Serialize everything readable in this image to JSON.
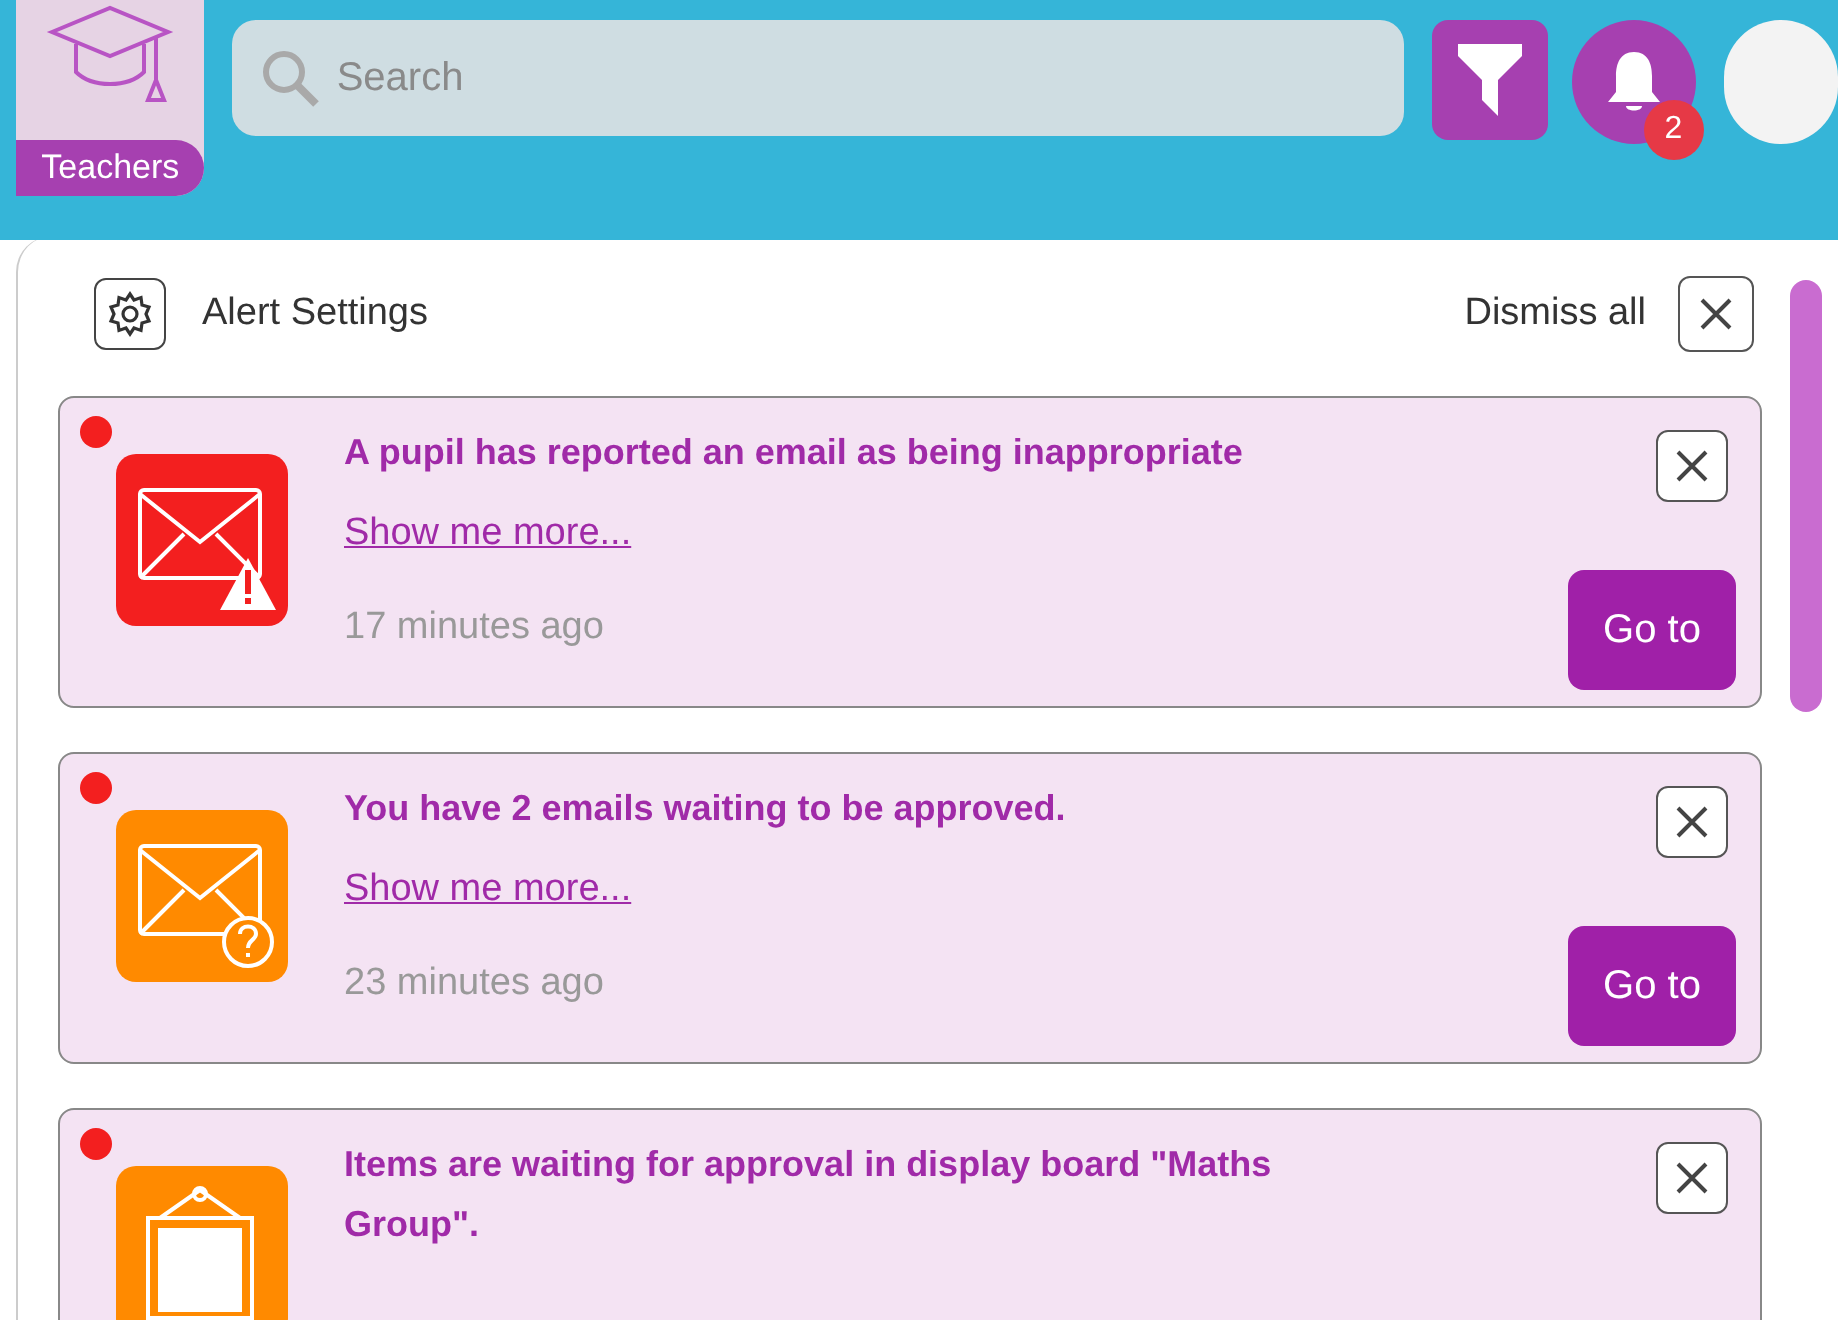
{
  "top_bar": {
    "role_tile": {
      "label": "Teachers"
    },
    "search": {
      "placeholder": "Search"
    },
    "notifications": {
      "badge": "2"
    }
  },
  "panel": {
    "settings_label": "Alert Settings",
    "dismiss_all": "Dismiss all",
    "alerts": [
      {
        "kind": "email-warning",
        "color": "#f31f1f",
        "unread": true,
        "title": "A pupil has reported an email as being inappropriate",
        "link": "Show me more...",
        "time": "17 minutes ago",
        "action": "Go to"
      },
      {
        "kind": "email-question",
        "color": "#ff8a00",
        "unread": true,
        "title": "You have 2 emails waiting to be approved.",
        "link": "Show me more...",
        "time": "23 minutes ago",
        "action": "Go to"
      },
      {
        "kind": "board",
        "color": "#ff8a00",
        "unread": true,
        "title": "Items are waiting for approval in display board \"Maths Group\"."
      }
    ]
  }
}
